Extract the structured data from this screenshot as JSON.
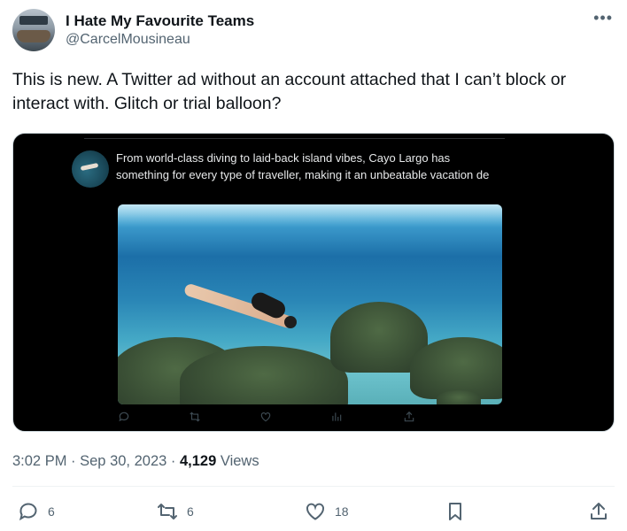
{
  "author": {
    "display_name": "I Hate My Favourite Teams",
    "handle": "@CarcelMousineau"
  },
  "menu_icon": "more-horizontal-icon",
  "tweet_text": "This is new. A Twitter ad without an account attached that I can’t block or interact with. Glitch or trial balloon?",
  "embedded_ad": {
    "text": "From world-class diving to laid-back island vibes, Cayo Largo has something for every type of traveller, making it an unbeatable vacation de",
    "image_alt": "Snorkeler diving over coral reef in clear turquoise water",
    "action_icons": [
      "reply-icon",
      "retweet-icon",
      "like-icon",
      "views-icon",
      "share-icon"
    ]
  },
  "meta": {
    "time": "3:02 PM",
    "separator": " · ",
    "date": "Sep 30, 2023",
    "views_count": "4,129",
    "views_label": "Views"
  },
  "actions": {
    "reply_count": "6",
    "retweet_count": "6",
    "like_count": "18"
  },
  "colors": {
    "text": "#0f1419",
    "secondary": "#536471",
    "media_bg": "#000000"
  }
}
